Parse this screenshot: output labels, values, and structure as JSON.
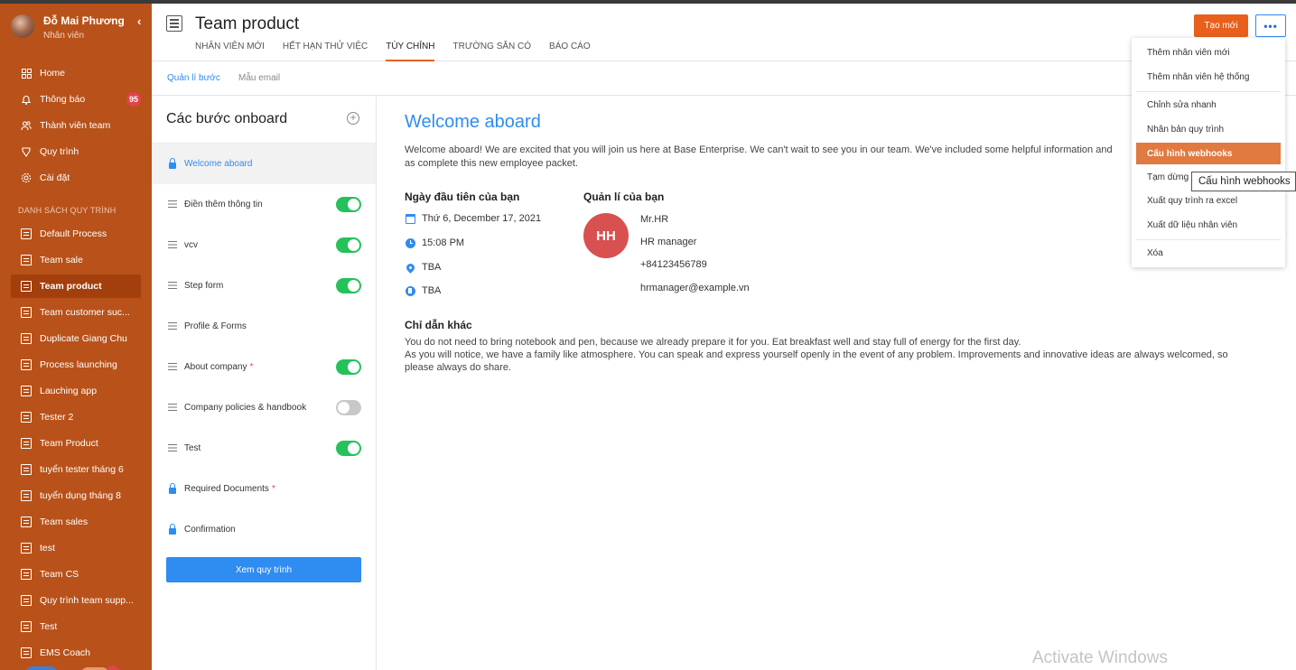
{
  "sidebar": {
    "user_name": "Đỗ Mai Phương",
    "user_role": "Nhân viên",
    "collapse_icon": "‹",
    "nav": [
      {
        "label": "Home",
        "icon": "grid-icon"
      },
      {
        "label": "Thông báo",
        "icon": "bell-icon",
        "badge": "95"
      },
      {
        "label": "Thành viên team",
        "icon": "users-icon"
      },
      {
        "label": "Quy trình",
        "icon": "process-icon"
      },
      {
        "label": "Cài đặt",
        "icon": "gear-icon"
      }
    ],
    "section_title": "DANH SÁCH QUY TRÌNH",
    "processes": [
      "Default Process",
      "Team sale",
      "Team product",
      "Team customer suc...",
      "Duplicate Giang Chu",
      "Process launching",
      "Lauching app",
      "Tester 2",
      "Team Product",
      "tuyển tester tháng 6",
      "tuyển dụng tháng 8",
      "Team sales",
      "test",
      "Team CS",
      "Quy trình team supp...",
      "Test",
      "EMS Coach"
    ],
    "active_process": "Team product"
  },
  "header": {
    "title": "Team product",
    "tabs": [
      "NHÂN VIÊN MỚI",
      "HẾT HẠN THỬ VIỆC",
      "TÙY CHỈNH",
      "TRƯỜNG SẴN CÓ",
      "BÁO CÁO"
    ],
    "active_tab": "TÙY CHỈNH",
    "create_label": "Tạo mới",
    "more_label": "•••"
  },
  "subtabs": [
    "Quản lí bước",
    "Mẫu email"
  ],
  "steps_panel": {
    "title": "Các bước onboard",
    "steps": [
      {
        "label": "Welcome aboard",
        "type": "locked",
        "active": true
      },
      {
        "label": "Điền thêm thông tin",
        "type": "drag",
        "toggle": "on"
      },
      {
        "label": "vcv",
        "type": "drag",
        "toggle": "on"
      },
      {
        "label": "Step form",
        "type": "drag",
        "toggle": "on"
      },
      {
        "label": "Profile & Forms",
        "type": "drag"
      },
      {
        "label": "About company",
        "type": "drag",
        "toggle": "on",
        "required": "*"
      },
      {
        "label": "Company policies & handbook",
        "type": "drag",
        "toggle": "off"
      },
      {
        "label": "Test",
        "type": "drag",
        "toggle": "on"
      },
      {
        "label": "Required Documents",
        "type": "locked",
        "required": "*"
      },
      {
        "label": "Confirmation",
        "type": "locked"
      }
    ],
    "view_button": "Xem quy trình"
  },
  "content": {
    "title": "Welcome aboard",
    "intro": "Welcome aboard! We are excited that you will join us here at Base Enterprise. We can't wait to see you in our team. We've included some helpful information and as complete this new employee packet.",
    "first_day_heading": "Ngày đầu tiên của bạn",
    "first_day": {
      "date": "Thứ 6, December 17, 2021",
      "time": "15:08 PM",
      "location": "TBA",
      "office": "TBA"
    },
    "manager_heading": "Quản lí của bạn",
    "manager": {
      "initials": "HH",
      "name": "Mr.HR",
      "title": "HR manager",
      "phone": "+84123456789",
      "email": "hrmanager@example.vn"
    },
    "other_heading": "Chỉ dẫn khác",
    "other_text_1": "You do not need to bring notebook and pen, because we already prepare it for you. Eat breakfast well and stay full of energy for the first day.",
    "other_text_2": "As you will notice, we have a family like atmosphere. You can speak and express yourself openly in the event of any problem. Improvements and innovative ideas are always welcomed, so please always do share."
  },
  "dropdown": {
    "items": [
      "Thêm nhân viên mới",
      "Thêm nhân viên hệ thống",
      "Chỉnh sửa nhanh",
      "Nhân bản quy trình",
      "Cấu hình webhooks",
      "Tạm dừng",
      "Xuất quy trình ra excel",
      "Xuất dữ liệu nhân viên",
      "Xóa"
    ],
    "active": "Cấu hình webhooks",
    "tooltip": "Cấu hình webhooks"
  },
  "watermark": "Activate Windows",
  "colors": {
    "sidebar": "#b8521a",
    "accent": "#e8601c",
    "link": "#2f8cf0",
    "toggle_on": "#25c15a",
    "avatar": "#d85050"
  }
}
